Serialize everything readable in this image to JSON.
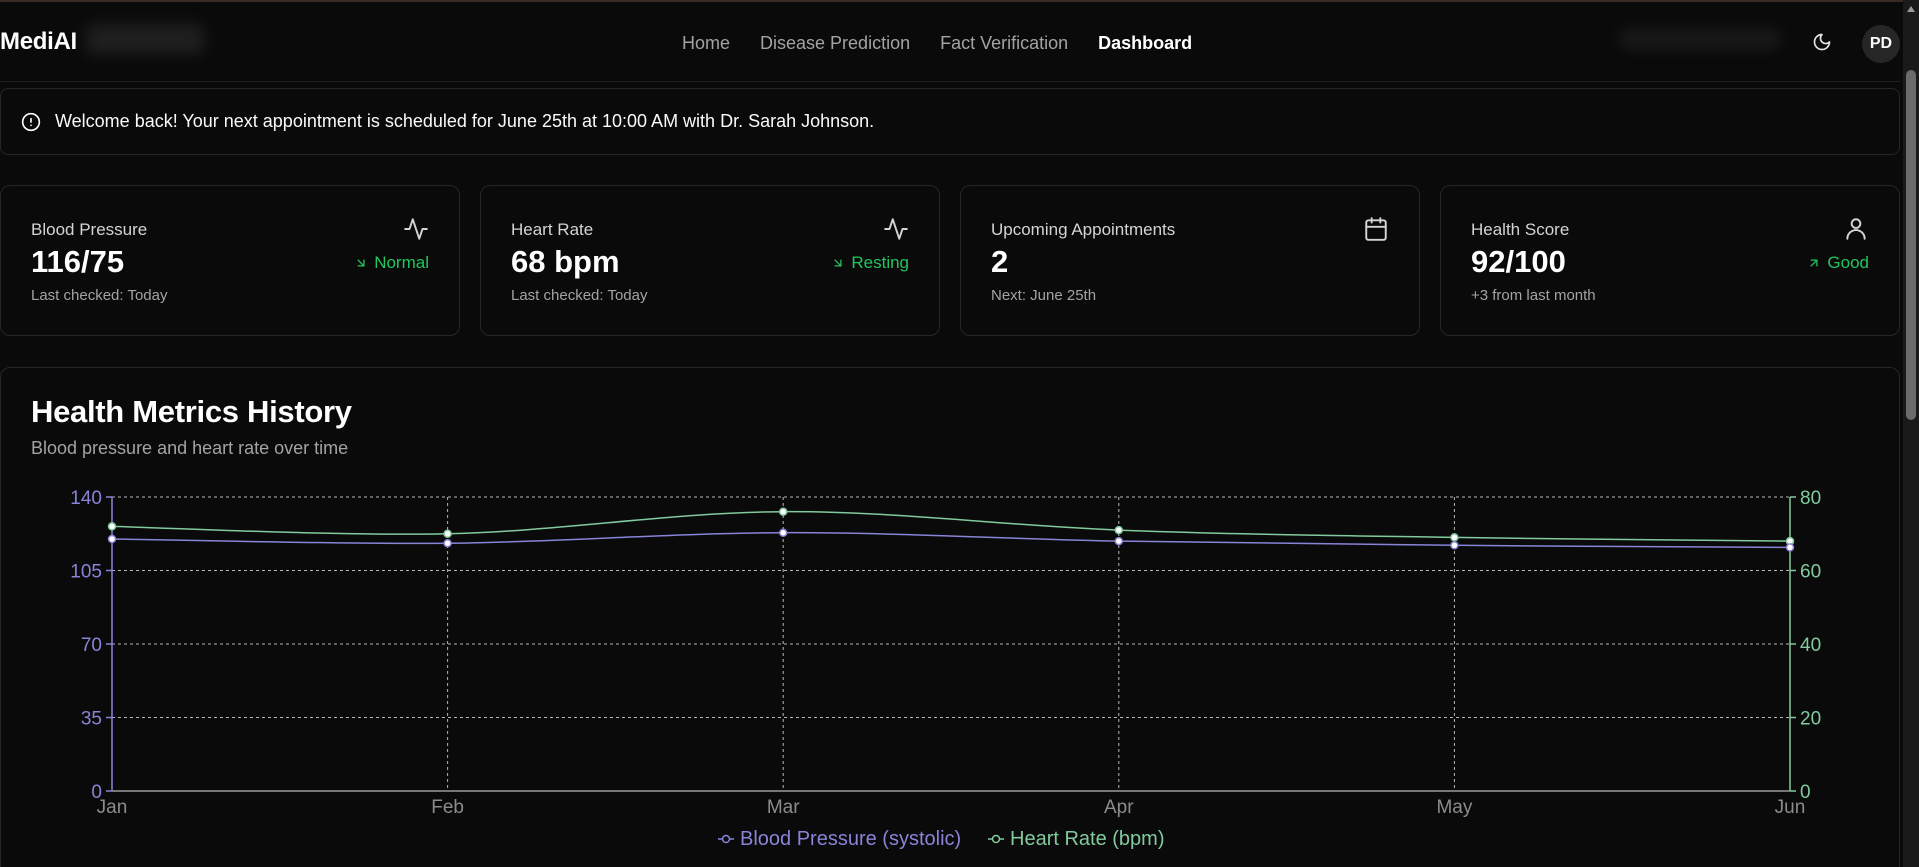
{
  "header": {
    "brand": "MediAI",
    "nav": [
      {
        "label": "Home",
        "active": false
      },
      {
        "label": "Disease Prediction",
        "active": false
      },
      {
        "label": "Fact Verification",
        "active": false
      },
      {
        "label": "Dashboard",
        "active": true
      }
    ],
    "theme_icon": "moon-icon",
    "avatar_initials": "PD"
  },
  "alert": {
    "icon": "alert-circle-icon",
    "text": "Welcome back! Your next appointment is scheduled for June 25th at 10:00 AM with Dr. Sarah Johnson."
  },
  "cards": [
    {
      "title": "Blood Pressure",
      "icon": "activity-icon",
      "value": "116/75",
      "trend": "Normal",
      "trend_icon": "arrow-down-right-icon",
      "sub": "Last checked: Today"
    },
    {
      "title": "Heart Rate",
      "icon": "activity-icon",
      "value": "68 bpm",
      "trend": "Resting",
      "trend_icon": "arrow-down-right-icon",
      "sub": "Last checked: Today"
    },
    {
      "title": "Upcoming Appointments",
      "icon": "calendar-icon",
      "value": "2",
      "trend": "",
      "trend_icon": "",
      "sub": "Next: June 25th"
    },
    {
      "title": "Health Score",
      "icon": "user-icon",
      "value": "92/100",
      "trend": "Good",
      "trend_icon": "arrow-up-right-icon",
      "sub": "+3 from last month"
    }
  ],
  "chart": {
    "title": "Health Metrics History",
    "subtitle": "Blood pressure and heart rate over time"
  },
  "colors": {
    "bp_series": "#8884d8",
    "hr_series": "#82ca9d",
    "trend_positive": "#22c55e",
    "grid": "#d4d4d4"
  },
  "chart_data": {
    "type": "line",
    "x": [
      "Jan",
      "Feb",
      "Mar",
      "Apr",
      "May",
      "Jun"
    ],
    "series": [
      {
        "name": "Blood Pressure (systolic)",
        "axis": "left",
        "values": [
          120,
          118,
          123,
          119,
          117,
          116
        ]
      },
      {
        "name": "Heart Rate (bpm)",
        "axis": "right",
        "values": [
          72,
          70,
          76,
          71,
          69,
          68
        ]
      }
    ],
    "y_left": {
      "ticks": [
        0,
        35,
        70,
        105,
        140
      ],
      "range": [
        0,
        140
      ]
    },
    "y_right": {
      "ticks": [
        0,
        20,
        40,
        60,
        80
      ],
      "range": [
        0,
        80
      ]
    },
    "grid": true,
    "legend_position": "bottom-center"
  }
}
